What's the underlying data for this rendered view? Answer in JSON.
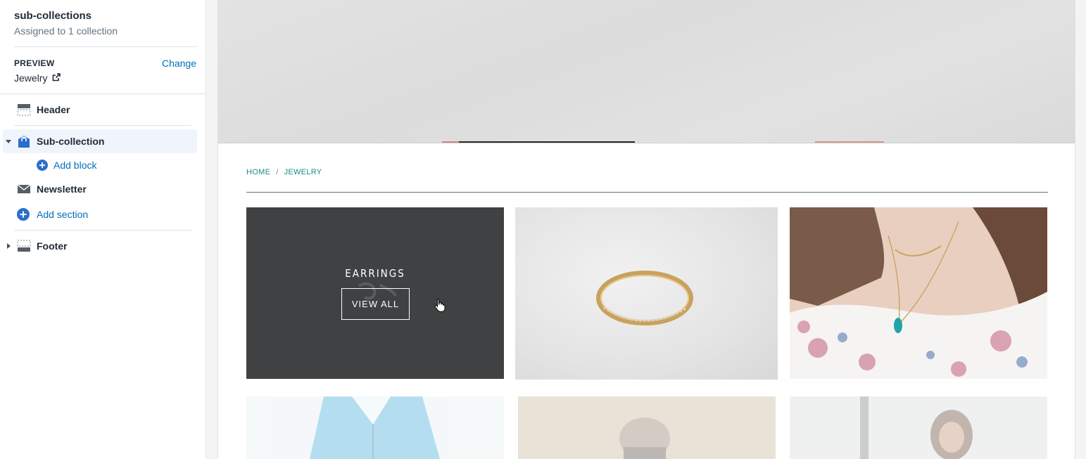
{
  "sidebar": {
    "template_title": "sub-collections",
    "template_subtitle": "Assigned to 1 collection",
    "preview_label": "PREVIEW",
    "change_label": "Change",
    "preview_value": "Jewelry",
    "sections": {
      "header": "Header",
      "sub_collection": "Sub-collection",
      "add_block": "Add block",
      "newsletter": "Newsletter",
      "add_section": "Add section",
      "footer": "Footer"
    }
  },
  "preview": {
    "breadcrumb": [
      "HOME",
      "/",
      "JEWELRY"
    ],
    "tile_overlay_title": "EARRINGS",
    "tile_overlay_button": "VIEW ALL"
  },
  "colors": {
    "link": "#006fbb",
    "breadcrumb": "#1b8a8a",
    "accent_icon": "#2c6ecb"
  }
}
